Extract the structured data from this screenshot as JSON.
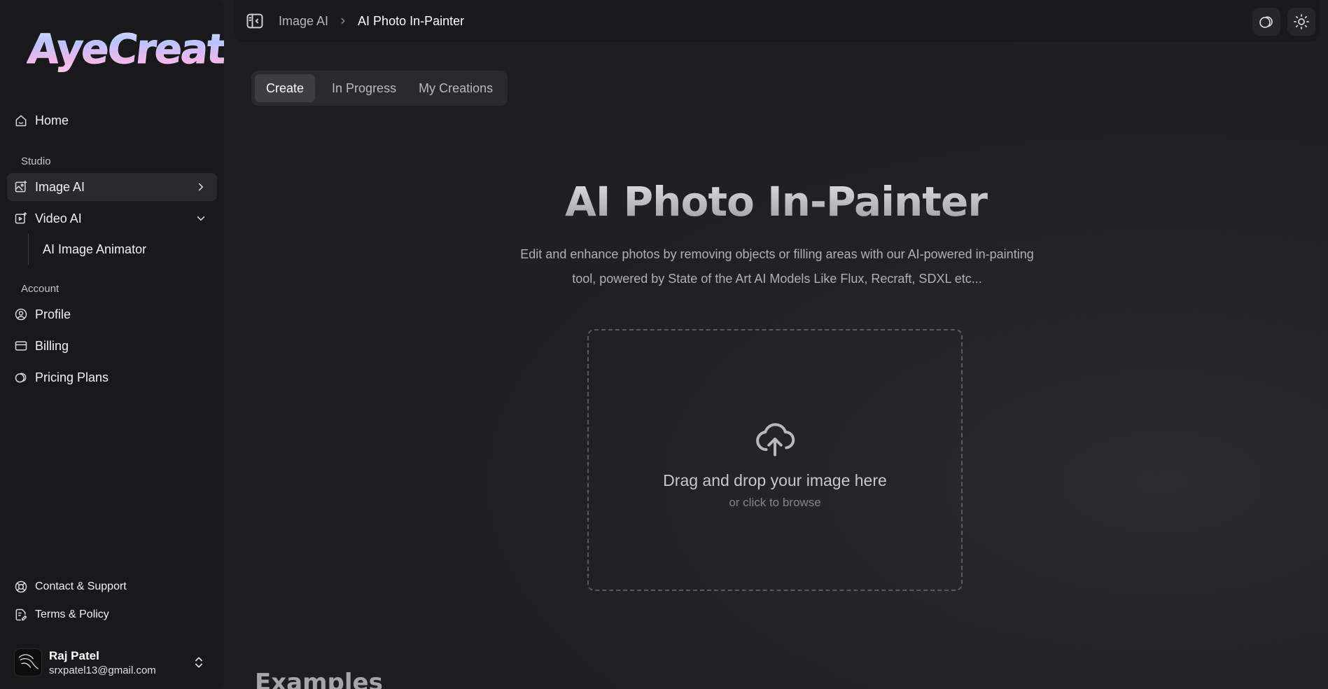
{
  "brand": {
    "logo_text": "AyeCreate"
  },
  "sidebar": {
    "home_label": "Home",
    "studio_label": "Studio",
    "studio_items": [
      {
        "label": "Image AI",
        "icon": "image-ai-icon",
        "active": true,
        "chevron": "right"
      },
      {
        "label": "Video AI",
        "icon": "video-ai-icon",
        "active": false,
        "chevron": "down"
      }
    ],
    "video_sub_items": [
      {
        "label": "AI Image Animator"
      }
    ],
    "account_label": "Account",
    "account_items": [
      {
        "label": "Profile",
        "icon": "user-circle-icon"
      },
      {
        "label": "Billing",
        "icon": "credit-card-icon"
      },
      {
        "label": "Pricing Plans",
        "icon": "coins-icon"
      }
    ],
    "footer_links": [
      {
        "label": "Contact & Support",
        "icon": "lifebuoy-icon"
      },
      {
        "label": "Terms & Policy",
        "icon": "document-icon"
      }
    ],
    "user": {
      "name": "Raj Patel",
      "email": "srxpatel13@gmail.com"
    }
  },
  "topbar": {
    "breadcrumb": [
      "Image AI",
      "AI Photo In-Painter"
    ]
  },
  "tabs": [
    {
      "label": "Create",
      "active": true
    },
    {
      "label": "In Progress",
      "active": false
    },
    {
      "label": "My Creations",
      "active": false
    }
  ],
  "hero": {
    "title": "AI Photo In-Painter",
    "description": "Edit and enhance photos by removing objects or filling areas with our AI-powered in-painting tool, powered by State of the Art AI Models Like Flux, Recraft, SDXL etc..."
  },
  "dropzone": {
    "primary": "Drag and drop your image here",
    "secondary": "or click to browse"
  },
  "examples_heading": "Examples",
  "colors": {
    "sidebar_bg": "#19191b",
    "main_bg": "#1e1e20",
    "active_item_bg": "#2a2a2d"
  }
}
